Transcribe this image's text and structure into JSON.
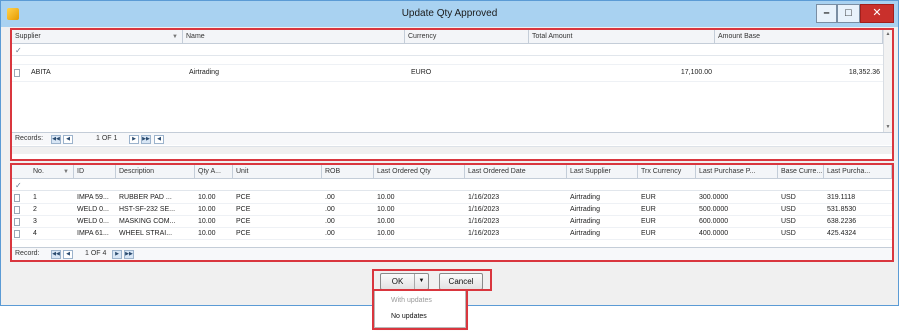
{
  "window": {
    "title": "Update Qty Approved",
    "min_glyph": "–",
    "max_glyph": "□",
    "close_glyph": "✕",
    "icon": "app-icon",
    "accent": "#a9d2f1",
    "highlight_color": "#d9363e"
  },
  "grid1": {
    "headers": [
      "Supplier",
      "Name",
      "Currency",
      "Total Amount",
      "Amount Base"
    ],
    "rows": [
      {
        "supplier": "ABITA",
        "name": "Airtrading",
        "currency": "EURO",
        "total_amount": "17,100.00",
        "amount_base": "18,352.36"
      }
    ],
    "nav": {
      "label": "Records",
      "position": "1 OF 1"
    }
  },
  "grid2": {
    "headers": [
      "No.",
      "ID",
      "Description",
      "Qty A...",
      "Unit",
      "ROB",
      "Last Ordered Qty",
      "Last Ordered Date",
      "Last Supplier",
      "Trx Currency",
      "Last Purchase P...",
      "Base Curre...",
      "Last Purcha..."
    ],
    "rows": [
      {
        "no": "1",
        "id": "IMPA 59...",
        "description": "RUBBER PAD ...",
        "qty": "10.00",
        "unit": "PCE",
        "rob": ".00",
        "last_qty": "10.00",
        "last_date": "1/16/2023",
        "last_supplier": "Airtrading",
        "trx_currency": "EUR",
        "last_price": "300.0000",
        "base_currency": "USD",
        "last_purchase": "319.1118"
      },
      {
        "no": "2",
        "id": "WELD 0...",
        "description": "HST-SF-232 SE...",
        "qty": "10.00",
        "unit": "PCE",
        "rob": ".00",
        "last_qty": "10.00",
        "last_date": "1/16/2023",
        "last_supplier": "Airtrading",
        "trx_currency": "EUR",
        "last_price": "500.0000",
        "base_currency": "USD",
        "last_purchase": "531.8530"
      },
      {
        "no": "3",
        "id": "WELD 0...",
        "description": "MASKING COM...",
        "qty": "10.00",
        "unit": "PCE",
        "rob": ".00",
        "last_qty": "10.00",
        "last_date": "1/16/2023",
        "last_supplier": "Airtrading",
        "trx_currency": "EUR",
        "last_price": "600.0000",
        "base_currency": "USD",
        "last_purchase": "638.2236"
      },
      {
        "no": "4",
        "id": "IMPA 61...",
        "description": "WHEEL STRAI...",
        "qty": "10.00",
        "unit": "PCE",
        "rob": ".00",
        "last_qty": "10.00",
        "last_date": "1/16/2023",
        "last_supplier": "Airtrading",
        "trx_currency": "EUR",
        "last_price": "400.0000",
        "base_currency": "USD",
        "last_purchase": "425.4324"
      }
    ],
    "nav": {
      "label": "Record",
      "position": "1 OF 4"
    }
  },
  "footer": {
    "ok_label": "OK",
    "cancel_label": "Cancel",
    "menu_items": [
      {
        "label": "With updates",
        "enabled": false
      },
      {
        "label": "No updates",
        "enabled": true
      }
    ]
  }
}
